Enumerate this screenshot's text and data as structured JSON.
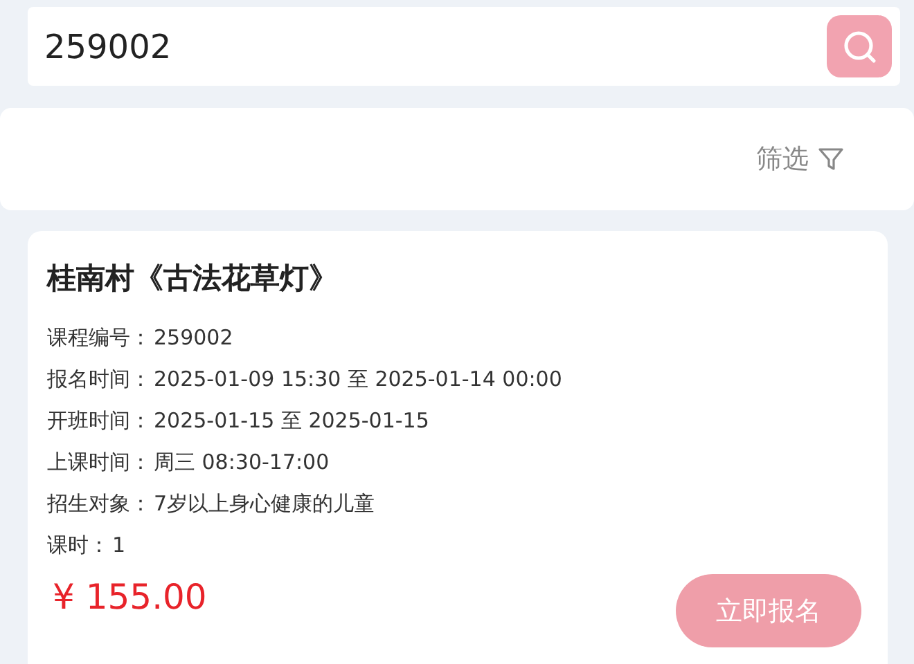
{
  "search": {
    "value": "259002"
  },
  "filter": {
    "label": "筛选"
  },
  "course": {
    "title": "桂南村《古法花草灯》",
    "fields": [
      {
        "label": "课程编号：",
        "value": "259002"
      },
      {
        "label": "报名时间：",
        "value": "2025-01-09 15:30 至 2025-01-14 00:00"
      },
      {
        "label": "开班时间：",
        "value": "2025-01-15 至 2025-01-15"
      },
      {
        "label": "上课时间：",
        "value": "周三 08:30-17:00"
      },
      {
        "label": "招生对象：",
        "value": "7岁以上身心健康的儿童"
      },
      {
        "label": "课时：",
        "value": "1"
      }
    ],
    "price": "¥ 155.00",
    "button": "立即报名"
  }
}
